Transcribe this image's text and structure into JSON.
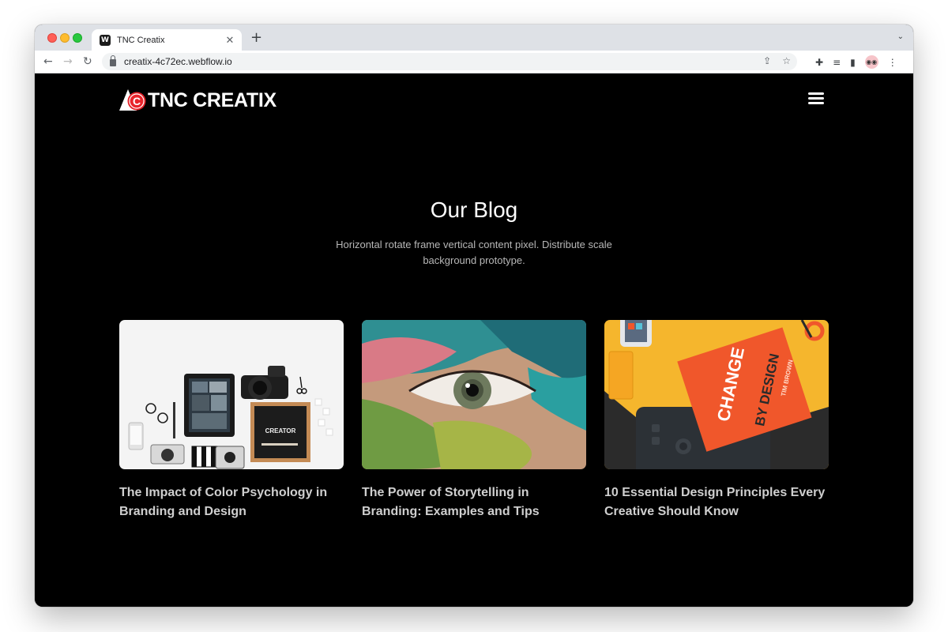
{
  "browser": {
    "tab_title": "TNC Creatix",
    "favicon_letter": "W",
    "url": "creatix-4c72ec.webflow.io",
    "avatar_glyph": "◉◉"
  },
  "site": {
    "logo_text": "TNC CREATIX",
    "logo_mark_letter": "C",
    "brand_red": "#e8232a"
  },
  "hero": {
    "title": "Our Blog",
    "subtitle": "Horizontal rotate frame vertical content pixel. Distribute scale background prototype."
  },
  "posts": [
    {
      "title": "The Impact of Color Psychology in Branding and Design",
      "image": "flatlay-creator-icon",
      "letterboard_text": "CREATOR"
    },
    {
      "title": "The Power of Storytelling in Branding: Examples and Tips",
      "image": "painted-eye-icon"
    },
    {
      "title": "10 Essential Design Principles Every Creative Should Know",
      "image": "change-by-design-book-icon",
      "book_text_top": "CHANGE",
      "book_text_bottom": "BY DESIGN",
      "book_author": "TIM BROWN"
    }
  ]
}
